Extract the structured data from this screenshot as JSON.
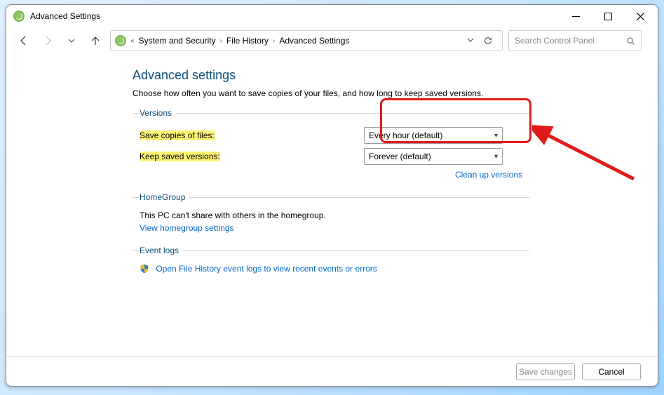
{
  "window": {
    "title": "Advanced Settings"
  },
  "breadcrumb": {
    "prefix": "«",
    "seg1": "System and Security",
    "seg2": "File History",
    "seg3": "Advanced Settings"
  },
  "search": {
    "placeholder": "Search Control Panel"
  },
  "page": {
    "title": "Advanced settings",
    "description": "Choose how often you want to save copies of your files, and how long to keep saved versions."
  },
  "groups": {
    "versions": {
      "legend": "Versions",
      "save_label": "Save copies of files:",
      "save_value": "Every hour (default)",
      "keep_label": "Keep saved versions:",
      "keep_value": "Forever (default)",
      "cleanup_link": "Clean up versions"
    },
    "homegroup": {
      "legend": "HomeGroup",
      "text": "This PC can't share with others in the homegroup.",
      "link": "View homegroup settings"
    },
    "eventlogs": {
      "legend": "Event logs",
      "link": "Open File History event logs to view recent events or errors"
    }
  },
  "footer": {
    "save": "Save changes",
    "cancel": "Cancel"
  }
}
